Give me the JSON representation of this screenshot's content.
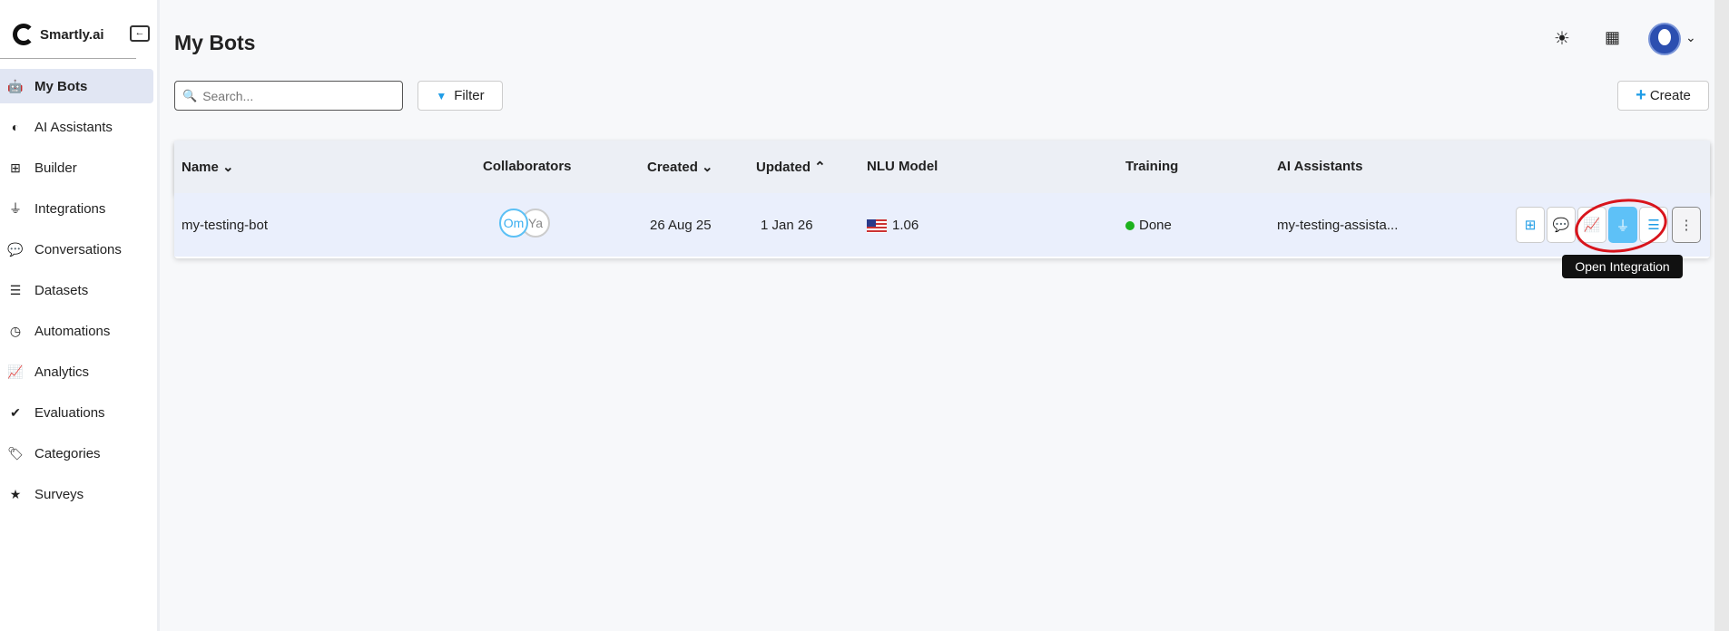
{
  "brand": {
    "name": "Smartly.ai"
  },
  "sidebar": {
    "items": [
      {
        "label": "My Bots",
        "icon": "robot-icon",
        "glyph": "🤖"
      },
      {
        "label": "AI Assistants",
        "icon": "brain-icon",
        "glyph": "◐"
      },
      {
        "label": "Builder",
        "icon": "sitemap-icon",
        "glyph": "⊞"
      },
      {
        "label": "Integrations",
        "icon": "plug-icon",
        "glyph": "⏚"
      },
      {
        "label": "Conversations",
        "icon": "comments-icon",
        "glyph": "💬"
      },
      {
        "label": "Datasets",
        "icon": "database-icon",
        "glyph": "☰"
      },
      {
        "label": "Automations",
        "icon": "clock-icon",
        "glyph": "◷"
      },
      {
        "label": "Analytics",
        "icon": "chart-line-icon",
        "glyph": "📈"
      },
      {
        "label": "Evaluations",
        "icon": "check-circle-icon",
        "glyph": "✔"
      },
      {
        "label": "Categories",
        "icon": "tag-icon",
        "glyph": "🏷"
      },
      {
        "label": "Surveys",
        "icon": "star-icon",
        "glyph": "★"
      }
    ]
  },
  "header": {
    "title": "My Bots"
  },
  "toolbar": {
    "search_placeholder": "Search...",
    "filter_label": "Filter",
    "create_label": "Create"
  },
  "table": {
    "columns": [
      "Name",
      "Collaborators",
      "Created",
      "Updated",
      "NLU Model",
      "Training",
      "AI Assistants"
    ],
    "sort_name": "⌄",
    "sort_created": "⌄",
    "sort_updated": "⌃",
    "rows": [
      {
        "name": "my-testing-bot",
        "collaborators": [
          "Om",
          "Ya"
        ],
        "created": "26 Aug 25",
        "updated": "1 Jan 26",
        "nlu_model": "1.06",
        "training": "Done",
        "ai_assistants": "my-testing-assista..."
      }
    ]
  },
  "tooltip": "Open Integration",
  "colors": {
    "accent": "#1e9ce6",
    "done": "#1db21d",
    "highlight": "#d8141c"
  }
}
